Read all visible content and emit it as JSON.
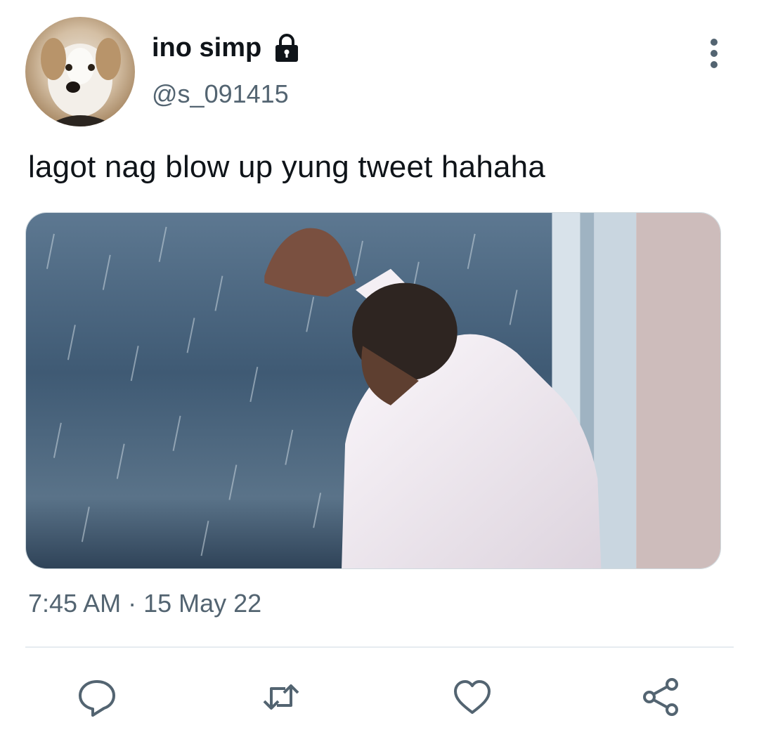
{
  "tweet": {
    "display_name": "ino simp",
    "handle": "@s_091415",
    "text": "lagot nag blow up yung tweet hahaha",
    "time": "7:45 AM",
    "separator": " · ",
    "date": "15 May 22"
  },
  "icons": {
    "lock": "lock-icon",
    "more": "more-vertical-icon",
    "reply": "reply-icon",
    "retweet": "retweet-icon",
    "like": "heart-icon",
    "share": "share-icon"
  },
  "colors": {
    "text": "#0f1419",
    "secondary": "#536471",
    "divider": "#e6ecf0",
    "icon": "#536471"
  }
}
